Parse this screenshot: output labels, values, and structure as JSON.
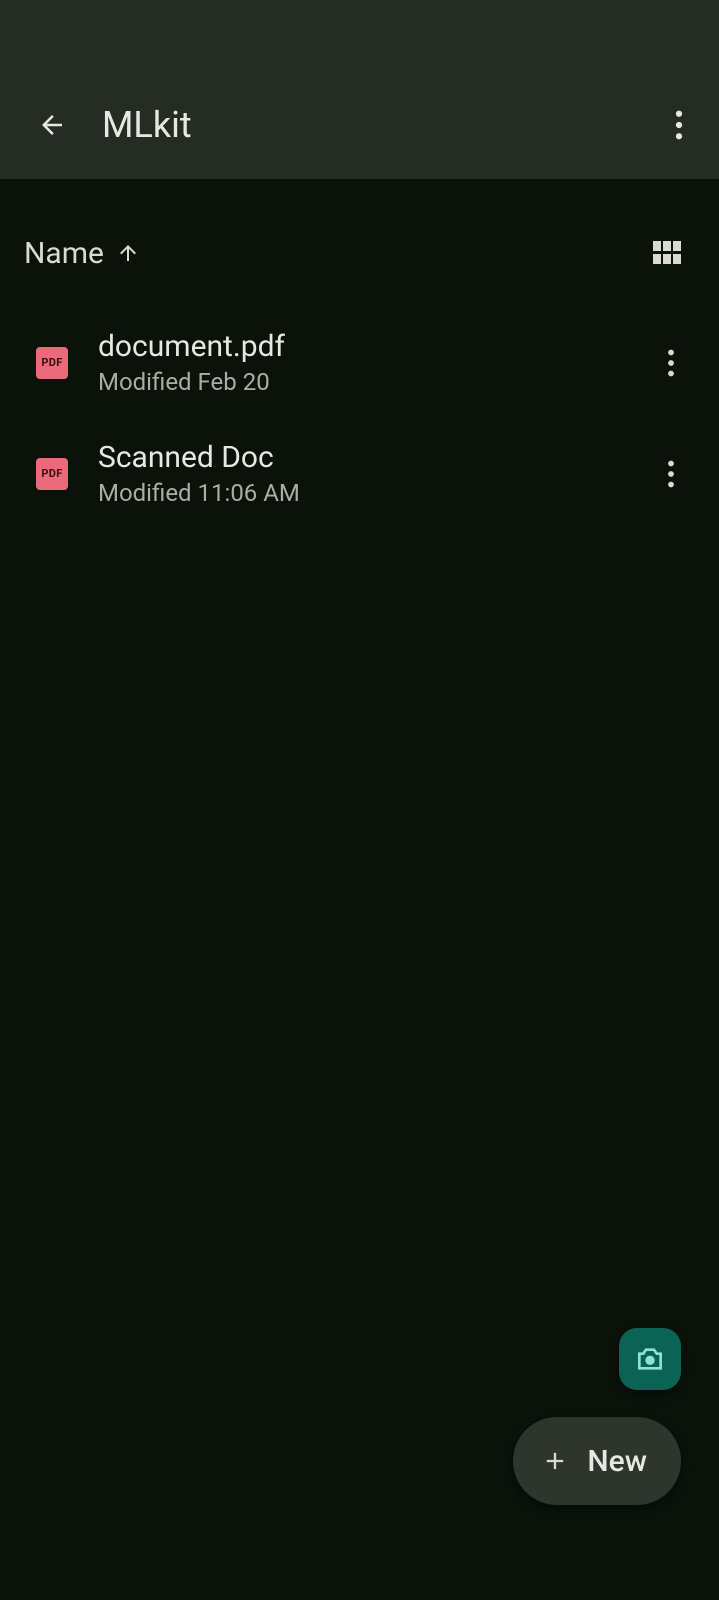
{
  "header": {
    "title": "MLkit"
  },
  "sort": {
    "label": "Name"
  },
  "files": [
    {
      "icon_label": "PDF",
      "name": "document.pdf",
      "meta": "Modified Feb 20"
    },
    {
      "icon_label": "PDF",
      "name": "Scanned Doc",
      "meta": "Modified 11:06 AM"
    }
  ],
  "fab": {
    "new_label": "New"
  }
}
